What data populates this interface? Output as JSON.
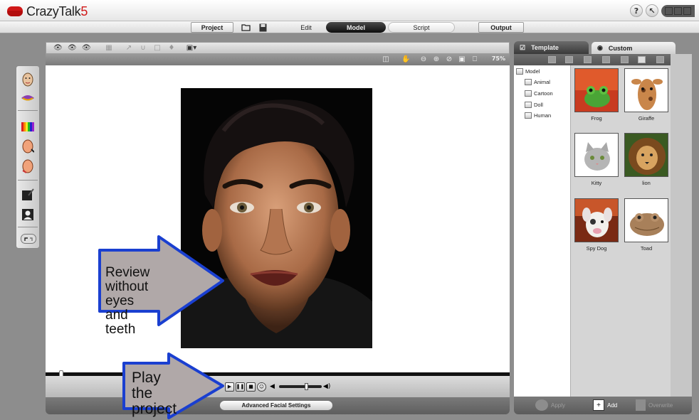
{
  "app": {
    "name_main": "CrazyTalk",
    "name_version": "5"
  },
  "titlebar": {
    "help_label": "?"
  },
  "modes": {
    "project": "Project",
    "edit": "Edit",
    "model": "Model",
    "script": "Script",
    "output": "Output"
  },
  "viewport": {
    "zoom": "75%"
  },
  "panel": {
    "tabs": {
      "template": "Template",
      "custom": "Custom"
    },
    "tree": {
      "root": "Model",
      "items": [
        "Animal",
        "Cartoon",
        "Doll",
        "Human"
      ]
    },
    "thumbnails": [
      "Frog",
      "Giraffe",
      "Kitty",
      "lion",
      "Spy Dog",
      "Toad"
    ],
    "buttons": {
      "apply": "Apply",
      "add": "Add",
      "overwrite": "Overwrite"
    }
  },
  "bottom": {
    "advanced_facial_settings": "Advanced Facial Settings"
  },
  "callouts": {
    "review": [
      "Review without",
      "eyes and teeth"
    ],
    "play": [
      "Play the",
      "project"
    ]
  },
  "colors": {
    "brand_red": "#d01818",
    "callout_border": "#1a3fd0",
    "callout_fill": "#b0a8a8"
  }
}
